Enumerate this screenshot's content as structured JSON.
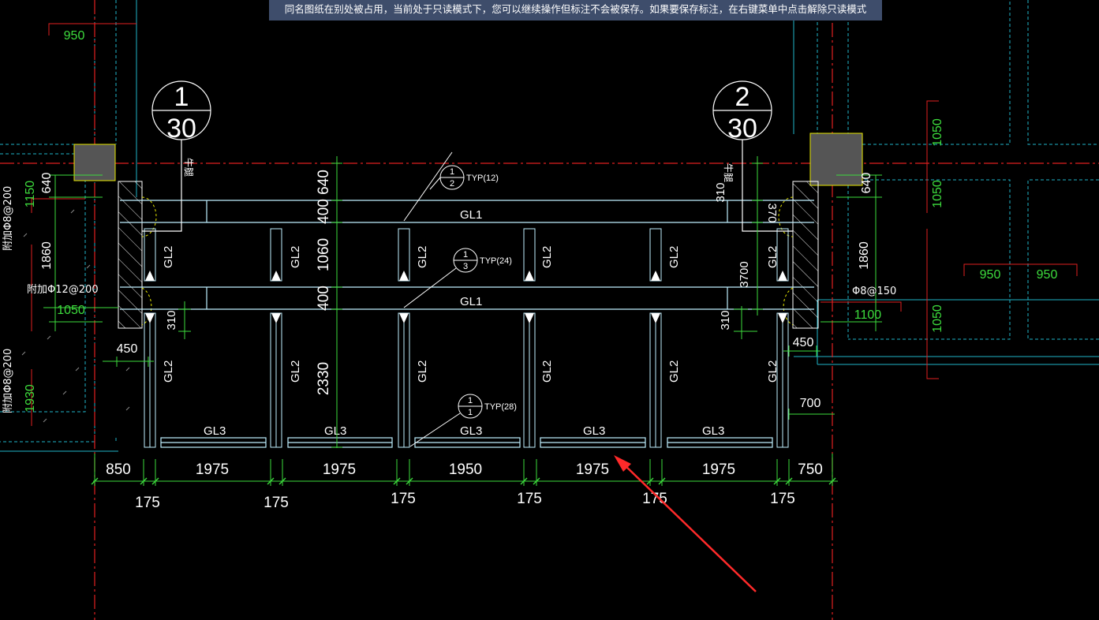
{
  "banner": {
    "text": "同名图纸在别处被占用，当前处于只读模式下，您可以继续操作但标注不会被保存。如果要保存标注，在右键菜单中点击解除只读模式"
  },
  "colors": {
    "background": "#000000",
    "beam": "#bfefff",
    "dimension": "#3ddc3d",
    "axis": "#e02020",
    "hidden": "#1fb3c8",
    "banner": "#3e4d6b",
    "column_fill": "#555555",
    "column_edge": "#e6e600",
    "arrow": "#ff2a2a"
  },
  "section_markers": [
    {
      "num": "1",
      "den": "30"
    },
    {
      "num": "2",
      "den": "30"
    }
  ],
  "detail_markers": [
    {
      "num": "1",
      "den": "2",
      "label": "TYP(12)"
    },
    {
      "num": "1",
      "den": "3",
      "label": "TYP(24)"
    },
    {
      "num": "1",
      "den": "1",
      "label": "TYP(28)"
    }
  ],
  "beams": {
    "gl1": "GL1",
    "gl2": "GL2",
    "gl3": "GL3"
  },
  "corbel_label": "牛腿",
  "bottom_dims": {
    "row1": [
      "850",
      "1975",
      "1975",
      "1950",
      "1975",
      "1975",
      "750"
    ],
    "row2": [
      "175",
      "175",
      "175",
      "175",
      "175",
      "175"
    ]
  },
  "vertical_dims": {
    "center": [
      "640",
      "400",
      "1060",
      "400",
      "2330"
    ],
    "right": [
      "310",
      "370",
      "3700",
      "310"
    ],
    "left_small": "310"
  },
  "side_dims": {
    "left": [
      "1150",
      "640",
      "1860",
      "1050",
      "1930",
      "450"
    ],
    "right": [
      "640",
      "1860",
      "450",
      "700",
      "1100"
    ],
    "far_right": [
      "1050",
      "1050",
      "1050"
    ],
    "top_left": "950",
    "mid_right_a": "950",
    "mid_right_b": "950"
  },
  "rebar_notes": {
    "left_top": "附加Φ8@200",
    "left_mid": "附加Φ12@200",
    "left_bottom": "附加Φ8@200",
    "right": "Φ8@150"
  }
}
